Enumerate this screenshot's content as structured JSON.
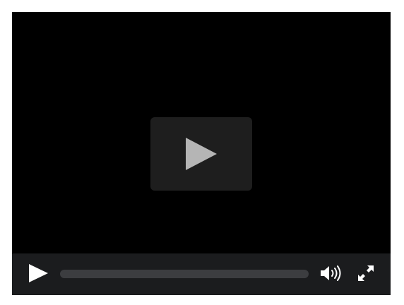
{
  "player": {
    "big_play_icon": "play-icon",
    "controls": {
      "play_icon": "play-icon",
      "volume_icon": "volume-icon",
      "fullscreen_icon": "expand-icon",
      "progress_fraction": 0
    }
  },
  "colors": {
    "video_background": "#000000",
    "control_bar": "#1b1c1e",
    "big_play_background": "#1e1e1e",
    "big_play_glyph": "#b5b5b5",
    "progress_track": "#3c3d40",
    "icon": "#ffffff"
  }
}
